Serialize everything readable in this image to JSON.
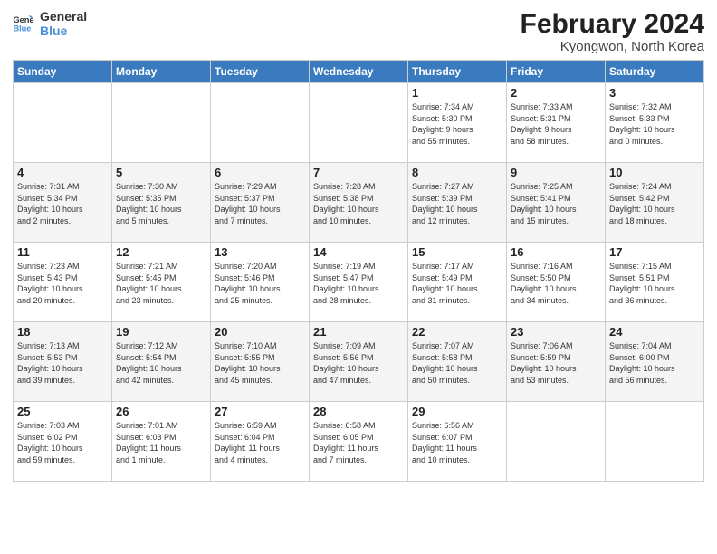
{
  "header": {
    "logo_line1": "General",
    "logo_line2": "Blue",
    "month_title": "February 2024",
    "location": "Kyongwon, North Korea"
  },
  "weekdays": [
    "Sunday",
    "Monday",
    "Tuesday",
    "Wednesday",
    "Thursday",
    "Friday",
    "Saturday"
  ],
  "weeks": [
    [
      {
        "day": "",
        "info": ""
      },
      {
        "day": "",
        "info": ""
      },
      {
        "day": "",
        "info": ""
      },
      {
        "day": "",
        "info": ""
      },
      {
        "day": "1",
        "info": "Sunrise: 7:34 AM\nSunset: 5:30 PM\nDaylight: 9 hours\nand 55 minutes."
      },
      {
        "day": "2",
        "info": "Sunrise: 7:33 AM\nSunset: 5:31 PM\nDaylight: 9 hours\nand 58 minutes."
      },
      {
        "day": "3",
        "info": "Sunrise: 7:32 AM\nSunset: 5:33 PM\nDaylight: 10 hours\nand 0 minutes."
      }
    ],
    [
      {
        "day": "4",
        "info": "Sunrise: 7:31 AM\nSunset: 5:34 PM\nDaylight: 10 hours\nand 2 minutes."
      },
      {
        "day": "5",
        "info": "Sunrise: 7:30 AM\nSunset: 5:35 PM\nDaylight: 10 hours\nand 5 minutes."
      },
      {
        "day": "6",
        "info": "Sunrise: 7:29 AM\nSunset: 5:37 PM\nDaylight: 10 hours\nand 7 minutes."
      },
      {
        "day": "7",
        "info": "Sunrise: 7:28 AM\nSunset: 5:38 PM\nDaylight: 10 hours\nand 10 minutes."
      },
      {
        "day": "8",
        "info": "Sunrise: 7:27 AM\nSunset: 5:39 PM\nDaylight: 10 hours\nand 12 minutes."
      },
      {
        "day": "9",
        "info": "Sunrise: 7:25 AM\nSunset: 5:41 PM\nDaylight: 10 hours\nand 15 minutes."
      },
      {
        "day": "10",
        "info": "Sunrise: 7:24 AM\nSunset: 5:42 PM\nDaylight: 10 hours\nand 18 minutes."
      }
    ],
    [
      {
        "day": "11",
        "info": "Sunrise: 7:23 AM\nSunset: 5:43 PM\nDaylight: 10 hours\nand 20 minutes."
      },
      {
        "day": "12",
        "info": "Sunrise: 7:21 AM\nSunset: 5:45 PM\nDaylight: 10 hours\nand 23 minutes."
      },
      {
        "day": "13",
        "info": "Sunrise: 7:20 AM\nSunset: 5:46 PM\nDaylight: 10 hours\nand 25 minutes."
      },
      {
        "day": "14",
        "info": "Sunrise: 7:19 AM\nSunset: 5:47 PM\nDaylight: 10 hours\nand 28 minutes."
      },
      {
        "day": "15",
        "info": "Sunrise: 7:17 AM\nSunset: 5:49 PM\nDaylight: 10 hours\nand 31 minutes."
      },
      {
        "day": "16",
        "info": "Sunrise: 7:16 AM\nSunset: 5:50 PM\nDaylight: 10 hours\nand 34 minutes."
      },
      {
        "day": "17",
        "info": "Sunrise: 7:15 AM\nSunset: 5:51 PM\nDaylight: 10 hours\nand 36 minutes."
      }
    ],
    [
      {
        "day": "18",
        "info": "Sunrise: 7:13 AM\nSunset: 5:53 PM\nDaylight: 10 hours\nand 39 minutes."
      },
      {
        "day": "19",
        "info": "Sunrise: 7:12 AM\nSunset: 5:54 PM\nDaylight: 10 hours\nand 42 minutes."
      },
      {
        "day": "20",
        "info": "Sunrise: 7:10 AM\nSunset: 5:55 PM\nDaylight: 10 hours\nand 45 minutes."
      },
      {
        "day": "21",
        "info": "Sunrise: 7:09 AM\nSunset: 5:56 PM\nDaylight: 10 hours\nand 47 minutes."
      },
      {
        "day": "22",
        "info": "Sunrise: 7:07 AM\nSunset: 5:58 PM\nDaylight: 10 hours\nand 50 minutes."
      },
      {
        "day": "23",
        "info": "Sunrise: 7:06 AM\nSunset: 5:59 PM\nDaylight: 10 hours\nand 53 minutes."
      },
      {
        "day": "24",
        "info": "Sunrise: 7:04 AM\nSunset: 6:00 PM\nDaylight: 10 hours\nand 56 minutes."
      }
    ],
    [
      {
        "day": "25",
        "info": "Sunrise: 7:03 AM\nSunset: 6:02 PM\nDaylight: 10 hours\nand 59 minutes."
      },
      {
        "day": "26",
        "info": "Sunrise: 7:01 AM\nSunset: 6:03 PM\nDaylight: 11 hours\nand 1 minute."
      },
      {
        "day": "27",
        "info": "Sunrise: 6:59 AM\nSunset: 6:04 PM\nDaylight: 11 hours\nand 4 minutes."
      },
      {
        "day": "28",
        "info": "Sunrise: 6:58 AM\nSunset: 6:05 PM\nDaylight: 11 hours\nand 7 minutes."
      },
      {
        "day": "29",
        "info": "Sunrise: 6:56 AM\nSunset: 6:07 PM\nDaylight: 11 hours\nand 10 minutes."
      },
      {
        "day": "",
        "info": ""
      },
      {
        "day": "",
        "info": ""
      }
    ]
  ]
}
